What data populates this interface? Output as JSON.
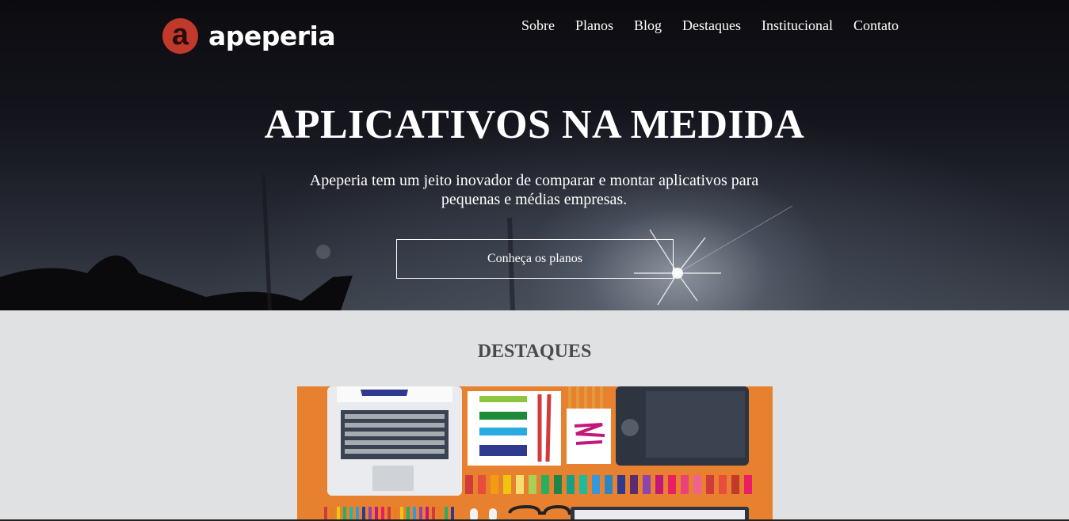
{
  "brand": {
    "logo_letter": "a",
    "name": "apeperia",
    "accent": "#c0392b"
  },
  "nav": {
    "items": [
      "Sobre",
      "Planos",
      "Blog",
      "Destaques",
      "Institucional",
      "Contato"
    ]
  },
  "hero": {
    "title": "APLICATIVOS NA MEDIDA",
    "subtitle": "Apeperia tem um jeito inovador de comparar e montar aplicativos para pequenas e médias empresas.",
    "cta_label": "Conheça os planos"
  },
  "featured": {
    "title": "DESTAQUES",
    "image_icon": "designer-desk-illustration",
    "image_bg": "#e8812f"
  }
}
